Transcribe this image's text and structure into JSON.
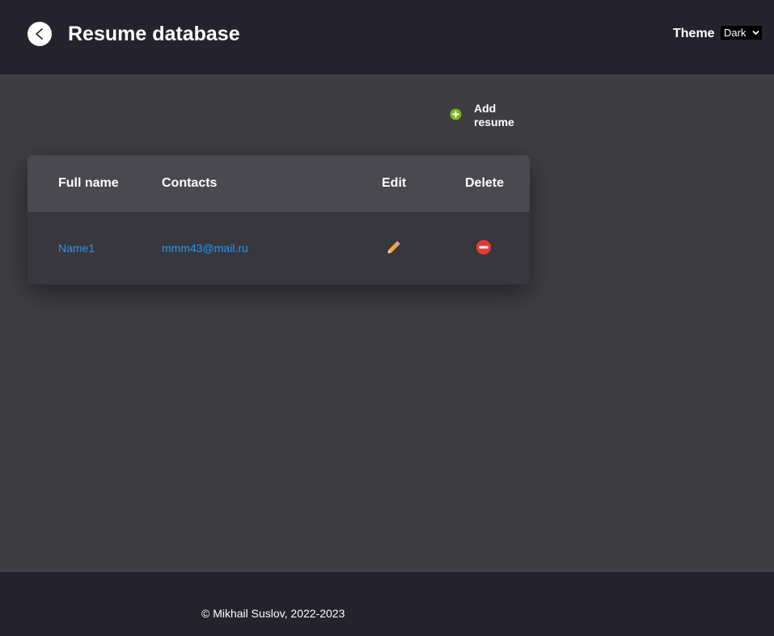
{
  "header": {
    "title": "Resume database",
    "theme_label": "Theme",
    "theme_select": {
      "selected": "Dark"
    }
  },
  "toolbar": {
    "add_label": "Add resume"
  },
  "table": {
    "columns": [
      "Full name",
      "Contacts",
      "Edit",
      "Delete"
    ],
    "rows": [
      {
        "full_name": "Name1",
        "contacts": "mmm43@mail.ru",
        "edit_icon": "pencil-icon",
        "delete_icon": "no-entry-icon"
      }
    ]
  },
  "footer": {
    "copyright": "© Mikhail Suslov, 2022-2023"
  },
  "colors": {
    "header_bg": "#23222d",
    "page_bg": "#3e3d42",
    "table_head_bg": "#4a494f",
    "link": "#2196f3",
    "add_icon": "#7cb518",
    "delete_icon": "#e53935"
  }
}
